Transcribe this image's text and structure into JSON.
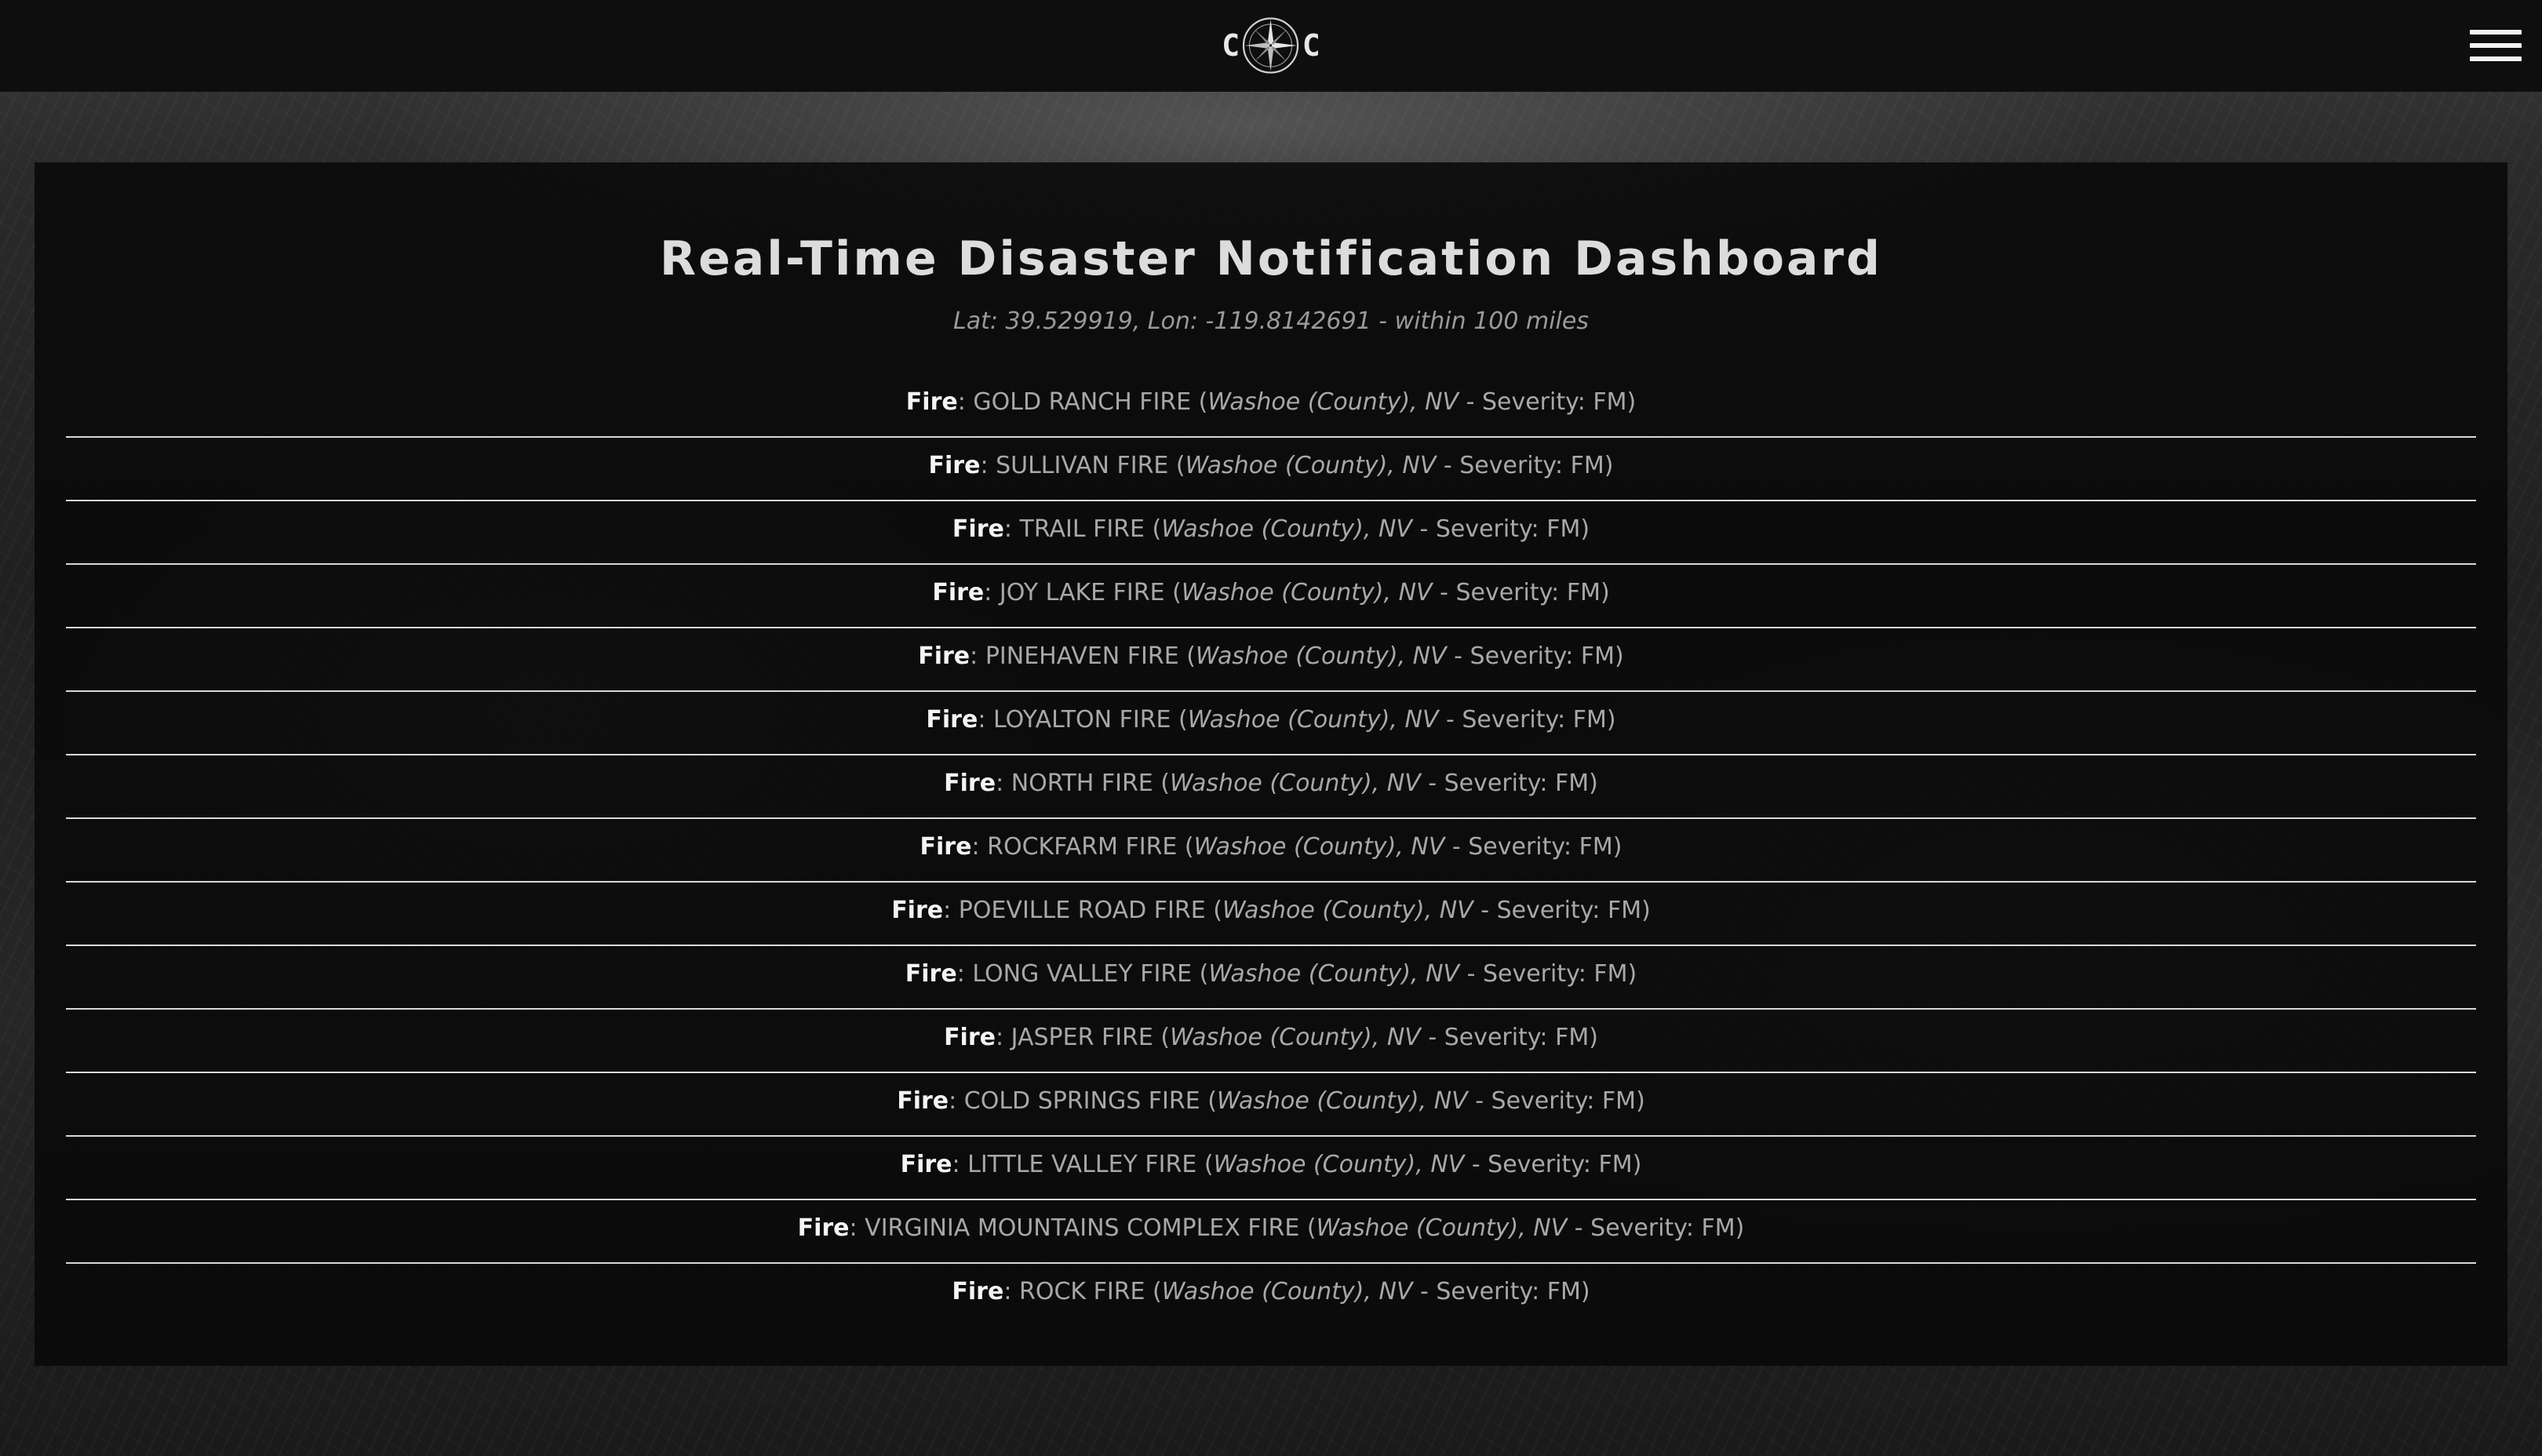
{
  "header": {
    "logo_left": "C",
    "logo_right": "C",
    "logo_icon": "compass-icon",
    "menu_icon": "hamburger-menu-icon"
  },
  "dashboard": {
    "title": "Real-Time Disaster Notification Dashboard",
    "subtitle": "Lat: 39.529919, Lon: -119.8142691 - within 100 miles",
    "alerts": [
      {
        "type": "Fire",
        "name": "GOLD RANCH FIRE",
        "county": "Washoe (County)",
        "state": "NV",
        "severity": "FM"
      },
      {
        "type": "Fire",
        "name": "SULLIVAN FIRE",
        "county": "Washoe (County)",
        "state": "NV",
        "severity": "FM"
      },
      {
        "type": "Fire",
        "name": "TRAIL FIRE",
        "county": "Washoe (County)",
        "state": "NV",
        "severity": "FM"
      },
      {
        "type": "Fire",
        "name": "JOY LAKE FIRE",
        "county": "Washoe (County)",
        "state": "NV",
        "severity": "FM"
      },
      {
        "type": "Fire",
        "name": "PINEHAVEN FIRE",
        "county": "Washoe (County)",
        "state": "NV",
        "severity": "FM"
      },
      {
        "type": "Fire",
        "name": "LOYALTON FIRE",
        "county": "Washoe (County)",
        "state": "NV",
        "severity": "FM"
      },
      {
        "type": "Fire",
        "name": "NORTH FIRE",
        "county": "Washoe (County)",
        "state": "NV",
        "severity": "FM"
      },
      {
        "type": "Fire",
        "name": "ROCKFARM FIRE",
        "county": "Washoe (County)",
        "state": "NV",
        "severity": "FM"
      },
      {
        "type": "Fire",
        "name": "POEVILLE ROAD FIRE",
        "county": "Washoe (County)",
        "state": "NV",
        "severity": "FM"
      },
      {
        "type": "Fire",
        "name": "LONG VALLEY FIRE",
        "county": "Washoe (County)",
        "state": "NV",
        "severity": "FM"
      },
      {
        "type": "Fire",
        "name": "JASPER FIRE",
        "county": "Washoe (County)",
        "state": "NV",
        "severity": "FM"
      },
      {
        "type": "Fire",
        "name": "COLD SPRINGS FIRE",
        "county": "Washoe (County)",
        "state": "NV",
        "severity": "FM"
      },
      {
        "type": "Fire",
        "name": "LITTLE VALLEY FIRE",
        "county": "Washoe (County)",
        "state": "NV",
        "severity": "FM"
      },
      {
        "type": "Fire",
        "name": "VIRGINIA MOUNTAINS COMPLEX FIRE",
        "county": "Washoe (County)",
        "state": "NV",
        "severity": "FM"
      },
      {
        "type": "Fire",
        "name": "ROCK FIRE",
        "county": "Washoe (County)",
        "state": "NV",
        "severity": "FM"
      }
    ]
  }
}
